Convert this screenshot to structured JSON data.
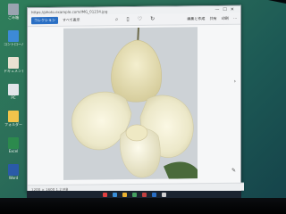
{
  "window": {
    "title": "https://photo.example.com/IMG_01234.jpg",
    "toolbar_button": "コレクション",
    "toolbar_label": "すべて表示",
    "toolbar_icons": [
      "zoom-in-icon",
      "delete-icon",
      "heart-icon",
      "rotate-icon"
    ],
    "edit_label": "編集と作成",
    "share_label": "共有",
    "print_label": "印刷",
    "more_label": "···",
    "status_text": "1200 × 1600   1.2 MB"
  },
  "photo": {
    "subject": "white slipper orchid",
    "description_colors": {
      "petal": "#f1efd7",
      "pouch": "#ecead1",
      "background": "#cfd4d8",
      "leaf": "#4a6a3a"
    }
  },
  "desktop": {
    "icons": [
      {
        "label": "ごみ箱",
        "color": "#9aa4b0"
      },
      {
        "label": "コントロール",
        "color": "#3d8ad6"
      },
      {
        "label": "ドキュメント",
        "color": "#e9e2d2"
      },
      {
        "label": "PC",
        "color": "#e2e5ea"
      },
      {
        "label": "フォルダー",
        "color": "#f1c44b"
      },
      {
        "label": "Excel",
        "color": "#2c8a4d"
      },
      {
        "label": "Word",
        "color": "#2a5aa8"
      }
    ]
  },
  "colors": {
    "accent_blue": "#2a6fc4",
    "desktop": "#2b6d59",
    "blue_dot": "#1f63d4",
    "red_dot": "#c91f24"
  }
}
